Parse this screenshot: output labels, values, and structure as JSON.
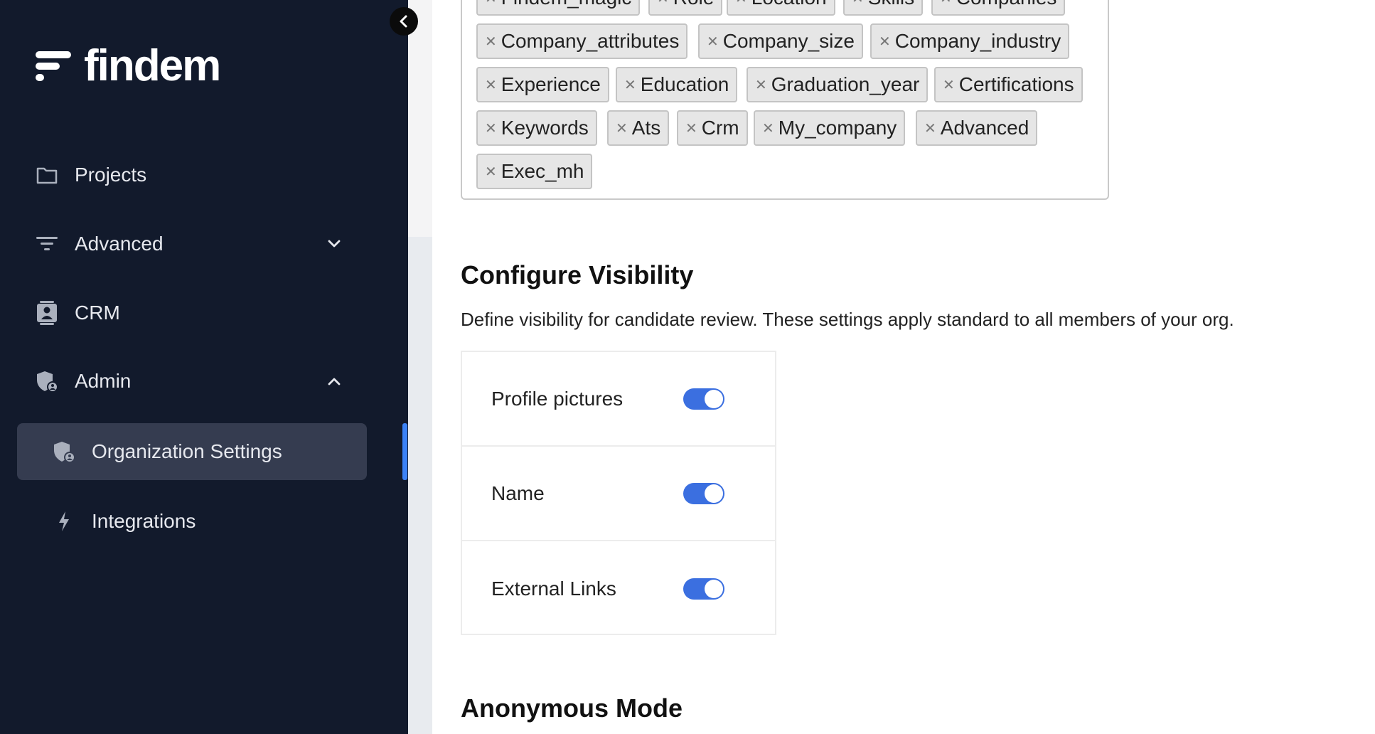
{
  "brand": {
    "logo_text": "findem"
  },
  "sidebar": {
    "items": [
      {
        "label": "Projects",
        "icon": "folder-icon"
      },
      {
        "label": "Advanced",
        "icon": "filter-icon",
        "expanded": false
      },
      {
        "label": "CRM",
        "icon": "contact-card-icon"
      },
      {
        "label": "Admin",
        "icon": "shield-user-icon",
        "expanded": true
      }
    ],
    "sub_items": [
      {
        "label": "Organization Settings",
        "icon": "shield-user-icon",
        "active": true
      },
      {
        "label": "Integrations",
        "icon": "bolt-icon",
        "active": false
      }
    ]
  },
  "tags": [
    "Findem_magic",
    "Role",
    "Location",
    "Skills",
    "Companies",
    "Company_attributes",
    "Company_size",
    "Company_industry",
    "Experience",
    "Education",
    "Graduation_year",
    "Certifications",
    "Keywords",
    "Ats",
    "Crm",
    "My_company",
    "Advanced",
    "Exec_mh"
  ],
  "visibility": {
    "title": "Configure Visibility",
    "description": "Define visibility for candidate review. These settings apply standard to all members of your org.",
    "rows": [
      {
        "label": "Profile pictures",
        "enabled": true
      },
      {
        "label": "Name",
        "enabled": true
      },
      {
        "label": "External Links",
        "enabled": true
      }
    ]
  },
  "anonymous": {
    "title": "Anonymous Mode"
  },
  "colors": {
    "sidebar_bg": "#121a2c",
    "active_bg": "#353c50",
    "accent": "#3b6fe0"
  }
}
